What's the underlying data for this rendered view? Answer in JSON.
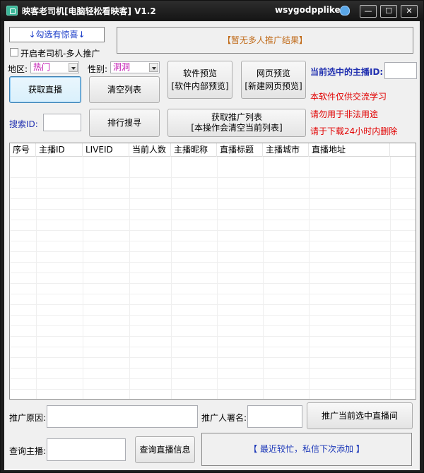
{
  "window": {
    "title": "映客老司机[电脑轻松看映客] V1.2",
    "username": "wsygodpplike",
    "controls": {
      "minimize": "—",
      "maximize": "☐",
      "close": "✕"
    }
  },
  "top": {
    "surprise_button": "↓勾选有惊喜↓",
    "multi_promo_checkbox": "开启老司机-多人推广",
    "promo_result": "【暂无多人推广结果】"
  },
  "filters": {
    "region_label": "地区:",
    "region_value": "热门",
    "gender_label": "性别:",
    "gender_value": "洞洞"
  },
  "buttons": {
    "get_live": "获取直播",
    "clear_list": "清空列表",
    "software_preview_line1": "软件预览",
    "software_preview_line2": "[软件内部预览]",
    "web_preview_line1": "网页预览",
    "web_preview_line2": "[新建网页预览]",
    "rank_search": "排行搜寻",
    "get_promo_line1": "获取推广列表",
    "get_promo_line2": "[本操作会清空当前列表]",
    "promote_current": "推广当前选中直播间",
    "query_live_info": "查询直播信息"
  },
  "search": {
    "label": "搜索ID:",
    "value": ""
  },
  "selected_anchor": {
    "label": "当前选中的主播ID:",
    "value": ""
  },
  "notices": [
    "本软件仅供交流学习",
    "请勿用于非法用途",
    "请于下载24小时内删除"
  ],
  "table": {
    "columns": [
      "序号",
      "主播ID",
      "LIVEID",
      "当前人数",
      "主播昵称",
      "直播标题",
      "主播城市",
      "直播地址"
    ]
  },
  "bottom": {
    "reason_label": "推广原因:",
    "reason_value": "",
    "signer_label": "推广人署名:",
    "signer_value": "",
    "query_label": "查询主播:",
    "query_value": "",
    "status_text": "【 最近较忙，私信下次添加 】"
  },
  "colors": {
    "titlebar": "#1a1a1a",
    "client": "#f0f0f0",
    "promo_text": "#c06a18",
    "notice_red": "#e10000",
    "label_blue": "#2130b0"
  }
}
